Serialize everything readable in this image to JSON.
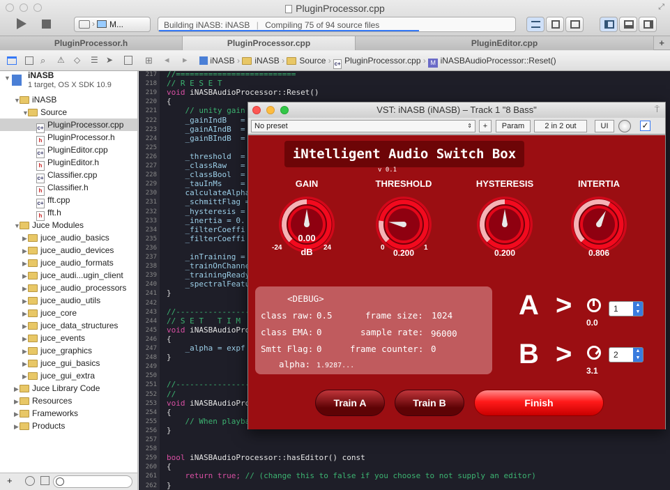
{
  "window": {
    "title": "PluginProcessor.cpp"
  },
  "toolbar": {
    "scheme": "M...",
    "activity_project": "Building iNASB: iNASB",
    "activity_status": "Compiling 75 of 94 source files"
  },
  "tabs": [
    {
      "label": "PluginProcessor.h"
    },
    {
      "label": "PluginProcessor.cpp"
    },
    {
      "label": "PluginEditor.cpp"
    }
  ],
  "breadcrumb": [
    "iNASB",
    "iNASB",
    "Source",
    "PluginProcessor.cpp",
    "iNASBAudioProcessor::Reset()"
  ],
  "navigator": {
    "project_name": "iNASB",
    "project_sub": "1 target, OS X SDK 10.9",
    "items": [
      "iNASB",
      "Source",
      "PluginProcessor.cpp",
      "PluginProcessor.h",
      "PluginEditor.cpp",
      "PluginEditor.h",
      "Classifier.cpp",
      "Classifier.h",
      "fft.cpp",
      "fft.h",
      "Juce Modules",
      "juce_audio_basics",
      "juce_audio_devices",
      "juce_audio_formats",
      "juce_audi...ugin_client",
      "juce_audio_processors",
      "juce_audio_utils",
      "juce_core",
      "juce_data_structures",
      "juce_events",
      "juce_graphics",
      "juce_gui_basics",
      "juce_gui_extra",
      "Juce Library Code",
      "Resources",
      "Frameworks",
      "Products"
    ]
  },
  "editor": {
    "line_numbers": [
      "217",
      "218",
      "219",
      "220",
      "221",
      "222",
      "223",
      "224",
      "225",
      "226",
      "227",
      "228",
      "229",
      "230",
      "231",
      "232",
      "233",
      "234",
      "235",
      "236",
      "237",
      "238",
      "239",
      "240",
      "241",
      "242",
      "243",
      "244",
      "245",
      "246",
      "247",
      "248",
      "249",
      "250",
      "251",
      "252",
      "253",
      "254",
      "255",
      "256",
      "257",
      "258",
      "259",
      "260",
      "261",
      "262"
    ],
    "lines": [
      "//==========================",
      "// R E S E T",
      "void iNASBAudioProcessor::Reset()",
      "{",
      "    // unity gain",
      "    _gainIndB   =",
      "    _gainAIndB  =",
      "    _gainBIndB  =",
      "",
      "    _threshold  =",
      "    _classRaw   =",
      "    _classBool  =",
      "    _tauInMs    =",
      "    calculateAlpha",
      "    _schmittFlag =",
      "    _hysteresis =",
      "    _inertia = 0.",
      "    _filterCoeffi",
      "    _filterCoeffi",
      "",
      "    _inTraining =",
      "    _trainOnChanne",
      "    _trainingReady",
      "    _spectralFeatu",
      "}",
      "",
      "//--------------------------",
      "// S E T   T I M",
      "void iNASBAudioProce",
      "{",
      "    _alpha = expf",
      "}",
      "",
      "",
      "//--------------------------",
      "//",
      "void iNASBAudioProce",
      "{",
      "    // When playba",
      "}",
      "",
      "",
      "bool iNASBAudioProcessor::hasEditor() const",
      "{",
      "    return true; // (change this to false if you choose to not supply an editor)",
      "}"
    ]
  },
  "vst": {
    "title": "VST: iNASB (iNASB) – Track 1 \"8 Bass\"",
    "preset": "No preset",
    "plus": "+",
    "param": "Param",
    "io": "2 in 2 out",
    "ui": "UI",
    "plugin_title": "iNtelligent Audio Switch Box",
    "version": "v 0.1",
    "knobs": [
      {
        "label": "GAIN",
        "value": "0.00",
        "min": "-24",
        "max": "24",
        "unit": "dB",
        "level": 0.5
      },
      {
        "label": "THRESHOLD",
        "value": "0.200",
        "min": "0",
        "max": "1",
        "level": 0.2
      },
      {
        "label": "HYSTERESIS",
        "value": "0.200",
        "level": 0.5
      },
      {
        "label": "INTERTIA",
        "value": "0.806",
        "level": 0.6
      }
    ],
    "debug": {
      "heading": "<DEBUG>",
      "class_raw_label": "class raw:",
      "class_raw": "0.5",
      "class_ema_label": "class EMA:",
      "class_ema": "0",
      "smtt_label": "Smtt Flag:",
      "smtt": "0",
      "alpha_label": "alpha:",
      "alpha": "1.9287...",
      "frame_size_label": "frame size:",
      "frame_size": "1024",
      "sample_rate_label": "sample rate:",
      "sample_rate": "96000",
      "frame_counter_label": "frame counter:",
      "frame_counter": "0"
    },
    "channel_a": {
      "letter": "A",
      "arrow": ">",
      "gain": "0.0",
      "channel": "1"
    },
    "channel_b": {
      "letter": "B",
      "arrow": ">",
      "gain": "3.1",
      "channel": "2"
    },
    "buttons": {
      "train_a": "Train A",
      "train_b": "Train B",
      "finish": "Finish"
    }
  }
}
